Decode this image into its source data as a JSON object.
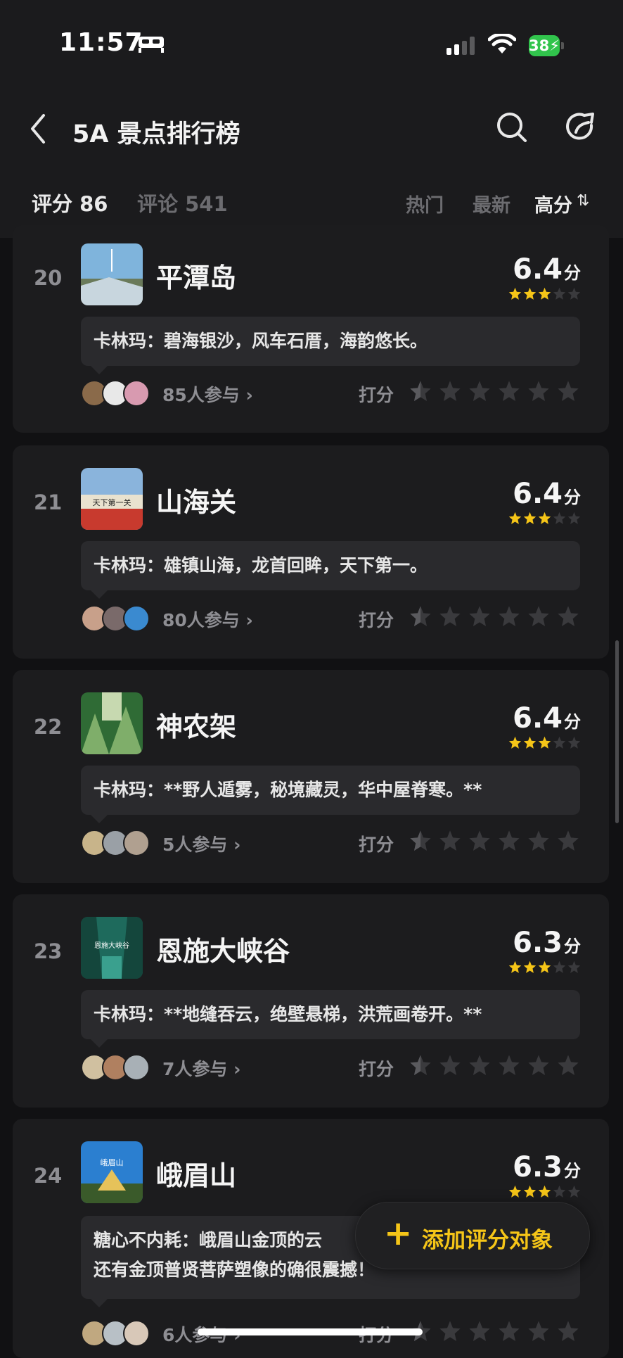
{
  "status_bar": {
    "time": "11:57",
    "battery": "38"
  },
  "header": {
    "title": "5A 景点排行榜"
  },
  "tabs": {
    "rating": "评分 86",
    "comments": "评论 541",
    "sort_hot": "热门",
    "sort_new": "最新",
    "sort_high": "高分"
  },
  "rate_label": "打分",
  "items": [
    {
      "rank": "20",
      "name": "平潭岛",
      "score": "6.4",
      "unit": "分",
      "stars": 3,
      "comment": "卡林玛：碧海银沙，风车石厝，海韵悠长。",
      "participants": "85人参与",
      "thumb_colors": [
        "#7fb4dc",
        "#c8d6de",
        "#6a7a5a"
      ]
    },
    {
      "rank": "21",
      "name": "山海关",
      "score": "6.4",
      "unit": "分",
      "stars": 3,
      "comment": "卡林玛：雄镇山海，龙首回眸，天下第一。",
      "participants": "80人参与",
      "thumb_colors": [
        "#8ab4dc",
        "#c83a2e",
        "#d9d3c4"
      ]
    },
    {
      "rank": "22",
      "name": "神农架",
      "score": "6.4",
      "unit": "分",
      "stars": 3,
      "comment": "卡林玛：**野人遁雾，秘境藏灵，华中屋脊寒。**",
      "participants": "5人参与",
      "thumb_colors": [
        "#2f6b35",
        "#7fae6a",
        "#c7d9b0"
      ]
    },
    {
      "rank": "23",
      "name": "恩施大峡谷",
      "score": "6.3",
      "unit": "分",
      "stars": 3,
      "comment": "卡林玛：**地缝吞云，绝壁悬梯，洪荒画卷开。**",
      "participants": "7人参与",
      "thumb_colors": [
        "#1e6a5c",
        "#3aa08e",
        "#9bd4c4"
      ]
    },
    {
      "rank": "24",
      "name": "峨眉山",
      "score": "6.3",
      "unit": "分",
      "stars": 3,
      "comment": "糖心不内耗：峨眉山金顶的云",
      "comment2": "还有金顶普贤菩萨塑像的确很震撼！",
      "participants": "6人参与",
      "thumb_colors": [
        "#2b7fd0",
        "#e6c25a",
        "#3a5a2a"
      ]
    }
  ],
  "thumb_text": {
    "item21": "天下第一关",
    "item23": "恩施大峡谷",
    "item24": "峨眉山"
  },
  "fab": {
    "label": "添加评分对象"
  },
  "colors": {
    "star": "#f5c518",
    "star_empty": "#3a3a3d",
    "background": "#111113",
    "card": "#1c1c1e"
  }
}
